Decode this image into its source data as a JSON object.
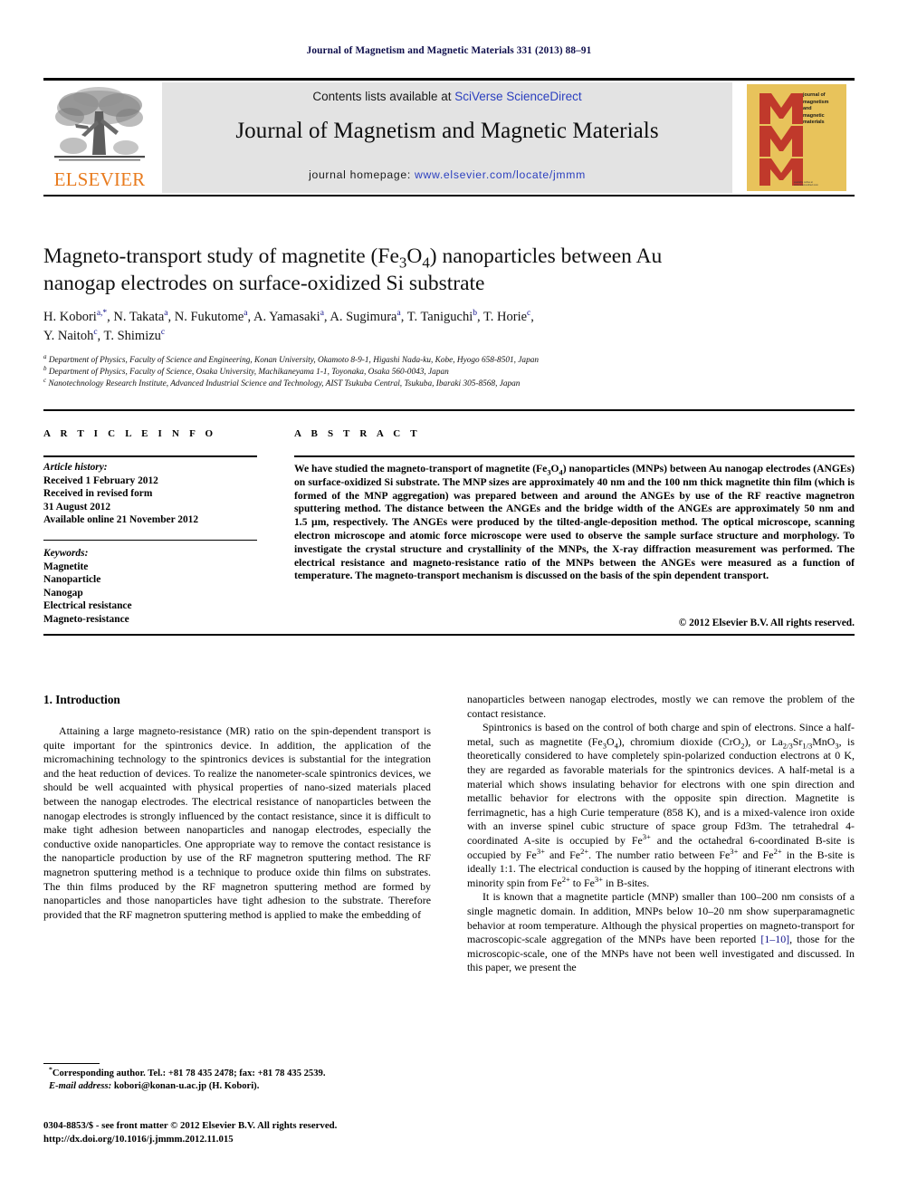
{
  "running_head": "Journal of Magnetism and Magnetic Materials 331 (2013) 88–91",
  "masthead": {
    "contents_prefix": "Contents lists available at ",
    "sciencedirect": "SciVerse ScienceDirect",
    "journal_title": "Journal of Magnetism and Magnetic Materials",
    "homepage_label": "journal homepage: ",
    "homepage_url": "www.elsevier.com/locate/jmmm",
    "elsevier_wordmark": "ELSEVIER",
    "elsevier_orange": "#E87B1E",
    "link_color": "#2b3fbf",
    "banner_bg": "#e3e3e3",
    "cover": {
      "bg_color": "#E8C35B",
      "letter_color": "#C0392B",
      "letters": "MMM",
      "caption_lines": [
        "journal of",
        "magnetism",
        "and",
        "magnetic",
        "materials"
      ],
      "footer_lines": [
        "available online at",
        "www.sciencedirect.com"
      ]
    }
  },
  "article": {
    "title_line1": "Magneto-transport study of magnetite (Fe",
    "title_sub1": "3",
    "title_line1b": "O",
    "title_sub2": "4",
    "title_line1c": ") nanoparticles between Au",
    "title_line2": "nanogap electrodes on surface-oxidized Si substrate",
    "authors": [
      {
        "name": "H. Kobori",
        "mark": "a,*"
      },
      {
        "name": "N. Takata",
        "mark": "a"
      },
      {
        "name": "N. Fukutome",
        "mark": "a"
      },
      {
        "name": "A. Yamasaki",
        "mark": "a"
      },
      {
        "name": "A. Sugimura",
        "mark": "a"
      },
      {
        "name": "T. Taniguchi",
        "mark": "b"
      },
      {
        "name": "T. Horie",
        "mark": "c"
      },
      {
        "name": "Y. Naitoh",
        "mark": "c"
      },
      {
        "name": "T. Shimizu",
        "mark": "c"
      }
    ],
    "affiliations": [
      {
        "mark": "a",
        "text": "Department of Physics, Faculty of Science and Engineering, Konan University, Okamoto 8-9-1, Higashi Nada-ku, Kobe, Hyogo 658-8501, Japan"
      },
      {
        "mark": "b",
        "text": "Department of Physics, Faculty of Science, Osaka University, Machikaneyama 1-1, Toyonaka, Osaka 560-0043, Japan"
      },
      {
        "mark": "c",
        "text": "Nanotechnology Research Institute, Advanced Industrial Science and Technology, AIST Tsukuba Central, Tsukuba, Ibaraki 305-8568, Japan"
      }
    ]
  },
  "article_info": {
    "heading": "A R T I C L E  I N F O",
    "history_label": "Article history:",
    "history_lines": [
      "Received 1 February 2012",
      "Received in revised form",
      "31 August 2012",
      "Available online 21 November 2012"
    ],
    "keywords_label": "Keywords:",
    "keywords": [
      "Magnetite",
      "Nanoparticle",
      "Nanogap",
      "Electrical resistance",
      "Magneto-resistance"
    ]
  },
  "abstract": {
    "heading": "A B S T R A C T",
    "text_before_formula": "We have studied the magneto-transport of magnetite (Fe",
    "text_after_formula": "O",
    "body": "We have studied the magneto-transport of magnetite (Fe3O4) nanoparticles (MNPs) between Au nanogap electrodes (ANGEs) on surface-oxidized Si substrate. The MNP sizes are approximately 40 nm and the 100 nm thick magnetite thin film (which is formed of the MNP aggregation) was prepared between and around the ANGEs by use of the RF reactive magnetron sputtering method. The distance between the ANGEs and the bridge width of the ANGEs are approximately 50 nm and 1.5 μm, respectively. The ANGEs were produced by the tilted-angle-deposition method. The optical microscope, scanning electron microscope and atomic force microscope were used to observe the sample surface structure and morphology. To investigate the crystal structure and crystallinity of the MNPs, the X-ray diffraction measurement was performed. The electrical resistance and magneto-resistance ratio of the MNPs between the ANGEs were measured as a function of temperature. The magneto-transport mechanism is discussed on the basis of the spin dependent transport.",
    "copyright": "© 2012 Elsevier B.V. All rights reserved."
  },
  "body": {
    "section_heading": "1.  Introduction",
    "left_paragraph_1": "Attaining a large magneto-resistance (MR) ratio on the spin-dependent transport is quite important for the spintronics device. In addition, the application of the micromachining technology to the spintronics devices is substantial for the integration and the heat reduction of devices. To realize the nanometer-scale spintronics devices, we should be well acquainted with physical properties of nano-sized materials placed between the nanogap electrodes. The electrical resistance of nanoparticles between the nanogap electrodes is strongly influenced by the contact resistance, since it is difficult to make tight adhesion between nanoparticles and nanogap electrodes, especially the conductive oxide nanoparticles. One appropriate way to remove the contact resistance is the nanoparticle production by use of the RF magnetron sputtering method. The RF magnetron sputtering method is a technique to produce oxide thin films on substrates. The thin films produced by the RF magnetron sputtering method are formed by nanoparticles and those nanoparticles have tight adhesion to the substrate. Therefore provided that the RF magnetron sputtering method is applied to make the embedding of",
    "right_paragraph_continued": "nanoparticles between nanogap electrodes, mostly we can remove the problem of the contact resistance.",
    "right_paragraph_2_parts": {
      "p1": "Spintronics is based on the control of both charge and spin of electrons. Since a half-metal, such as magnetite (Fe",
      "p2": "), chromium dioxide (CrO",
      "p3": "), or La",
      "p4": "Sr",
      "p5": "MnO",
      "p6": ", is theoretically considered to have completely spin-polarized conduction electrons at 0 K, they are regarded as favorable materials for the spintronics devices. A half-metal is a material which shows insulating behavior for electrons with one spin direction and metallic behavior for electrons with the opposite spin direction. Magnetite is ferrimagnetic, has a high Curie temperature (858 K), and is a mixed-valence iron oxide with an inverse spinel cubic structure of space group Fd3m. The tetrahedral 4-coordinated A-site is occupied by Fe",
      "p7": " and the octahedral 6-coordinated B-site is occupied by Fe",
      "p8": " and Fe",
      "p9": ". The number ratio between Fe",
      "p10": " and Fe",
      "p11": " in the B-site is ideally 1:1. The electrical conduction is caused by the hopping of itinerant electrons with minority spin from Fe",
      "p12": " to Fe",
      "p13": " in B-sites."
    },
    "right_paragraph_3_parts": {
      "a": "It is known that a magnetite particle (MNP) smaller than 100–200 nm consists of a single magnetic domain. In addition, MNPs below 10–20 nm show superparamagnetic behavior at room temperature. Although the physical properties on magneto-transport for macroscopic-scale aggregation of the MNPs have been reported ",
      "ref": "[1–10]",
      "b": ", those for the microscopic-scale, one of the MNPs have not been well investigated and discussed. In this paper, we present the"
    }
  },
  "footer": {
    "corresponding_author": "Corresponding author. Tel.: +81 78 435 2478; fax: +81 78 435 2539.",
    "email_label": "E-mail address:",
    "email": "kobori@konan-u.ac.jp (H. Kobori).",
    "issn_line": "0304-8853/$ - see front matter © 2012 Elsevier B.V. All rights reserved.",
    "doi_line": "http://dx.doi.org/10.1016/j.jmmm.2012.11.015"
  }
}
